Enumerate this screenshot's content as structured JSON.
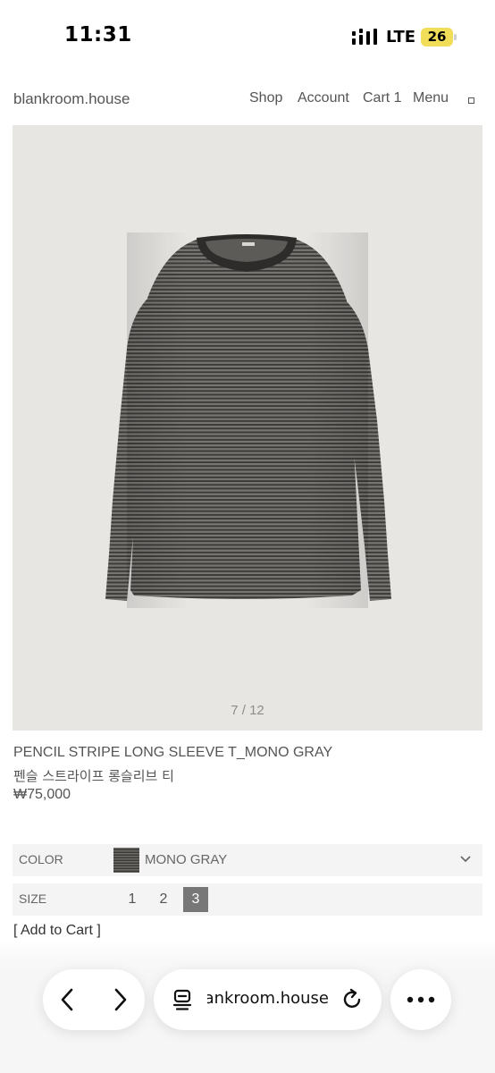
{
  "status_bar": {
    "time": "11:31",
    "network": "LTE",
    "battery": "26",
    "battery_color": "#f1dd57"
  },
  "header": {
    "logo": "blankroom.house",
    "nav": [
      "Shop",
      "Account",
      "Cart 1",
      "Menu"
    ]
  },
  "gallery": {
    "counter": "7 / 12",
    "current": 7,
    "total": 12
  },
  "product": {
    "name": "PENCIL STRIPE LONG SLEEVE T_MONO GRAY",
    "name_ko": "펜슬 스트라이프 롱슬리브 티",
    "price": "₩75,000"
  },
  "options": {
    "color_label": "COLOR",
    "color_value": "MONO GRAY",
    "size_label": "SIZE",
    "sizes": [
      "1",
      "2",
      "3"
    ],
    "selected_size": "3"
  },
  "add_to_cart": "[ Add to Cart ]",
  "browser": {
    "url": "blankroom.house",
    "icons": [
      "back-icon",
      "forward-icon",
      "tabs-icon",
      "reload-icon",
      "more-icon"
    ]
  }
}
